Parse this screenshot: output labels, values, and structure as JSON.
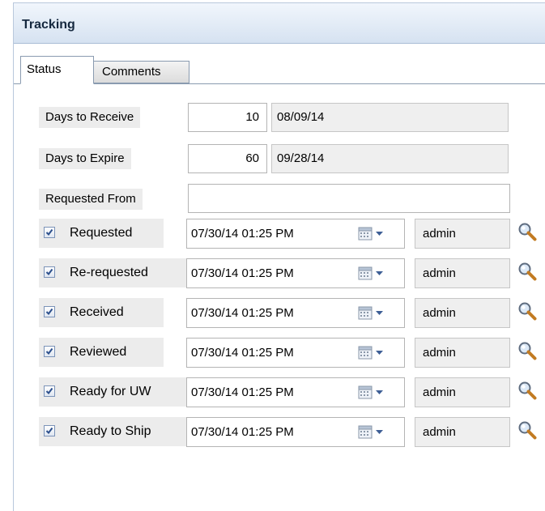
{
  "panel": {
    "title": "Tracking"
  },
  "tabs": [
    {
      "label": "Status",
      "active": true
    },
    {
      "label": "Comments",
      "active": false
    }
  ],
  "fields": {
    "days_to_receive": {
      "label": "Days to Receive",
      "value": "10",
      "date": "08/09/14"
    },
    "days_to_expire": {
      "label": "Days to Expire",
      "value": "60",
      "date": "09/28/14"
    },
    "requested_from": {
      "label": "Requested From",
      "value": ""
    }
  },
  "tracking_rows": [
    {
      "label": "Requested",
      "checked": true,
      "datetime": "07/30/14 01:25 PM",
      "user": "admin"
    },
    {
      "label": "Re-requested",
      "checked": true,
      "datetime": "07/30/14 01:25 PM",
      "user": "admin"
    },
    {
      "label": "Received",
      "checked": true,
      "datetime": "07/30/14 01:25 PM",
      "user": "admin"
    },
    {
      "label": "Reviewed",
      "checked": true,
      "datetime": "07/30/14 01:25 PM",
      "user": "admin"
    },
    {
      "label": "Ready for UW",
      "checked": true,
      "datetime": "07/30/14 01:25 PM",
      "user": "admin"
    },
    {
      "label": "Ready to Ship",
      "checked": true,
      "datetime": "07/30/14 01:25 PM",
      "user": "admin"
    }
  ],
  "icons": {
    "checkbox": "checkmark-icon",
    "date_picker": "calendar-dropdown-icon",
    "user_lookup": "magnifier-search-icon"
  },
  "colors": {
    "header_bg": "#dde7f4",
    "check_mark": "#2c4f8c",
    "field_readonly_bg": "#efefef"
  }
}
